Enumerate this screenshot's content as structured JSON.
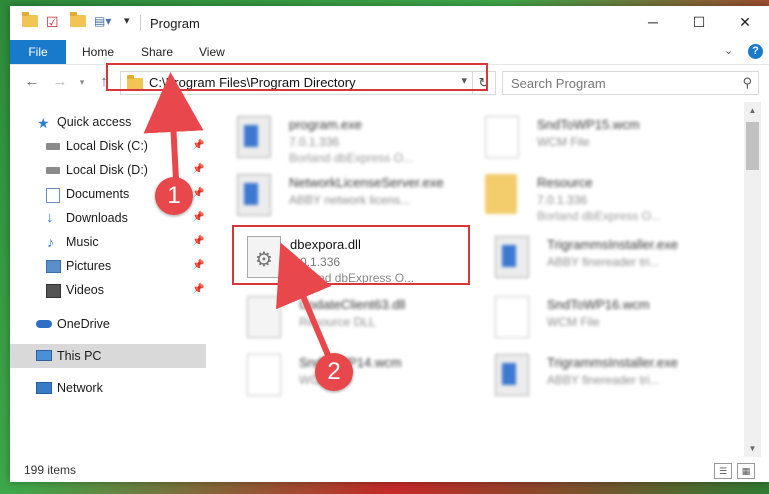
{
  "window": {
    "title": "Program"
  },
  "window_controls": {
    "minimize": "─",
    "maximize": "☐",
    "close": "✕"
  },
  "ribbon": {
    "tabs": [
      "File",
      "Home",
      "Share",
      "View"
    ],
    "help": "?"
  },
  "nav": {
    "back": "←",
    "forward": "→",
    "up": "↑",
    "address": "C:\\Program Files\\Program Directory",
    "search_placeholder": "Search Program"
  },
  "sidebar": {
    "items": [
      {
        "label": "Quick access",
        "icon": "star-icon"
      },
      {
        "label": "Local Disk (C:)",
        "icon": "drive-icon"
      },
      {
        "label": "Local Disk (D:)",
        "icon": "drive-icon"
      },
      {
        "label": "Documents",
        "icon": "documents-icon"
      },
      {
        "label": "Downloads",
        "icon": "download-icon"
      },
      {
        "label": "Music",
        "icon": "music-icon"
      },
      {
        "label": "Pictures",
        "icon": "pictures-icon"
      },
      {
        "label": "Videos",
        "icon": "videos-icon"
      },
      {
        "label": "OneDrive",
        "icon": "cloud-icon"
      },
      {
        "label": "This PC",
        "icon": "computer-icon"
      },
      {
        "label": "Network",
        "icon": "network-icon"
      }
    ],
    "pin": "📌"
  },
  "files": [
    {
      "name": "program.exe",
      "version": "7.0.1.336",
      "desc": "Borland dbExpress O..."
    },
    {
      "name": "SndToWP15.wcm",
      "version": "WCM File",
      "desc": ""
    },
    {
      "name": "NetworkLicenseServer.exe",
      "version": "ABBY network licens...",
      "desc": ""
    },
    {
      "name": "Resource",
      "version": "7.0.1.336",
      "desc": "Borland dbExpress O..."
    },
    {
      "name": "dbexpora.dll",
      "version": "7.0.1.336",
      "desc": "Borland dbExpress O..."
    },
    {
      "name": "TrigrammsInstaller.exe",
      "version": "ABBY finereader tri...",
      "desc": ""
    },
    {
      "name": "UpdateClient63.dll",
      "version": "Resource DLL",
      "desc": ""
    },
    {
      "name": "SndToWP16.wcm",
      "version": "WCM File",
      "desc": ""
    },
    {
      "name": "SndToWP14.wcm",
      "version": "WCM File",
      "desc": ""
    },
    {
      "name": "TrigrammsInstaller.exe",
      "version": "ABBY finereader tri...",
      "desc": ""
    }
  ],
  "status": {
    "count": "199 items"
  },
  "annotations": {
    "step1": "1",
    "step2": "2"
  },
  "colors": {
    "accent": "#1979ca",
    "highlight": "#d9363b",
    "badge": "#e8474b"
  }
}
